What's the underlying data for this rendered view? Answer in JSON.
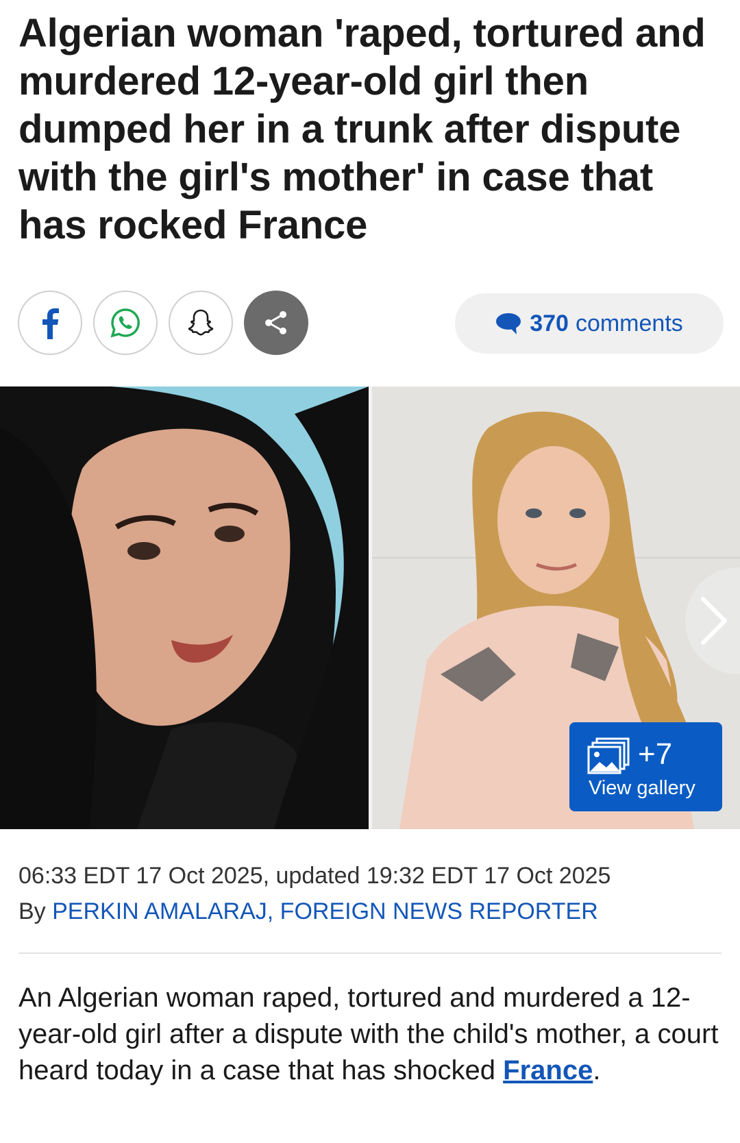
{
  "article": {
    "headline": "Algerian woman 'raped, tortured and murdered 12-year-old girl then dumped her in a trunk after dispute with the girl's mother' in case that has rocked France",
    "timestamp": "06:33 EDT 17 Oct 2025, updated 19:32 EDT 17 Oct 2025",
    "byline_prefix": "By ",
    "author": "PERKIN AMALARAJ, FOREIGN NEWS REPORTER",
    "body_before_link": "An Algerian woman raped, tortured and murdered a 12-year-old girl after a dispute with the child's mother, a court heard today in a case that has shocked ",
    "body_link": "France",
    "body_after_link": "."
  },
  "share": {
    "buttons": [
      {
        "icon": "facebook-icon"
      },
      {
        "icon": "whatsapp-icon"
      },
      {
        "icon": "snapchat-icon"
      },
      {
        "icon": "share-icon"
      }
    ],
    "comments_count": "370",
    "comments_label": "comments"
  },
  "gallery": {
    "count": "+7",
    "label": "View gallery"
  },
  "colors": {
    "link": "#1356b8",
    "gallery_button": "#0a5cc4",
    "whatsapp": "#1fa855"
  }
}
